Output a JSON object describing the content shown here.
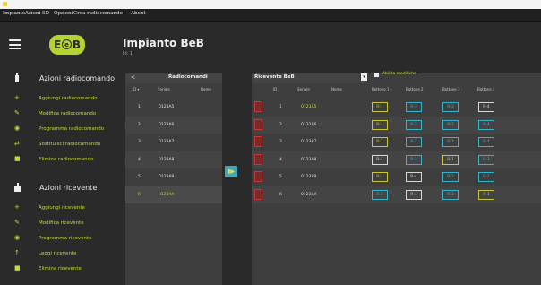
{
  "window": {
    "menu": [
      "Impianto",
      "Azioni SD",
      "Opzioni",
      "Crea radiocomando",
      "About"
    ]
  },
  "app": {
    "title": "Impianto BeB",
    "id": "Id: 1"
  },
  "logo": {
    "text_left": "E",
    "text_center": "e",
    "text_right": "B"
  },
  "sidebar": {
    "remote_heading": "Azioni radiocomando",
    "remote_items": [
      {
        "icon": "+",
        "label": "Aggiungi radiocomando"
      },
      {
        "icon": "✎",
        "label": "Modifica radiocomando"
      },
      {
        "icon": "◉",
        "label": "Programma radiocomando"
      },
      {
        "icon": "⇄",
        "label": "Sostituisci radiocomando"
      },
      {
        "icon": "■",
        "label": "Elimina radiocomando"
      }
    ],
    "receiver_heading": "Azioni ricevente",
    "receiver_items": [
      {
        "icon": "+",
        "label": "Aggiungi ricevente"
      },
      {
        "icon": "✎",
        "label": "Modifica ricevente"
      },
      {
        "icon": "◉",
        "label": "Programma ricevente"
      },
      {
        "icon": "↑",
        "label": "Leggi ricevente"
      },
      {
        "icon": "■",
        "label": "Elimina ricevente"
      }
    ]
  },
  "remotes_panel": {
    "back": "<",
    "title": "Radiocomandi",
    "columns": [
      "ID",
      "Seriale",
      "Nome"
    ],
    "rows": [
      {
        "id": "1",
        "serial": "0123A5",
        "name": "",
        "selected": false
      },
      {
        "id": "2",
        "serial": "0123A6",
        "name": "",
        "selected": false
      },
      {
        "id": "3",
        "serial": "0123A7",
        "name": "",
        "selected": false
      },
      {
        "id": "4",
        "serial": "0123A8",
        "name": "",
        "selected": false
      },
      {
        "id": "5",
        "serial": "0123A9",
        "name": "",
        "selected": false
      },
      {
        "id": "6",
        "serial": "0123AA",
        "name": "",
        "selected": true
      }
    ]
  },
  "transfer_button": {
    "label": "▮▶"
  },
  "receiver_panel": {
    "title": "Ricevente BeB",
    "dropdown": "▾",
    "checkbox_label": "Abilita modifiche",
    "columns": [
      "ID",
      "Seriale",
      "Nome",
      "Bottone 1",
      "Bottone 2",
      "Bottone 3",
      "Bottone 4"
    ],
    "rows": [
      {
        "id": "1",
        "serial": "0123A5",
        "highlight": true,
        "buttons": [
          {
            "t": "R-1",
            "c": "#c9c63a"
          },
          {
            "t": "R-3",
            "c": "#3ab3c9"
          },
          {
            "t": "R-3",
            "c": "#3ab3c9"
          },
          {
            "t": "R-4",
            "c": "#d8d8d8"
          }
        ]
      },
      {
        "id": "2",
        "serial": "0123A6",
        "highlight": false,
        "buttons": [
          {
            "t": "R-1",
            "c": "#c9c63a"
          },
          {
            "t": "R-2",
            "c": "#3ab3c9"
          },
          {
            "t": "R-3",
            "c": "#3ab3c9"
          },
          {
            "t": "R-4",
            "c": "#3ab3c9"
          }
        ]
      },
      {
        "id": "3",
        "serial": "0123A7",
        "highlight": false,
        "buttons": [
          {
            "t": "R-1",
            "c": "#c9c63a"
          },
          {
            "t": "R-2",
            "c": "#3ab3c9"
          },
          {
            "t": "R-3",
            "c": "#3ab3c9"
          },
          {
            "t": "R-4",
            "c": "#3ab3c9"
          }
        ]
      },
      {
        "id": "4",
        "serial": "0123A8",
        "highlight": false,
        "buttons": [
          {
            "t": "R-4",
            "c": "#d8d8d8"
          },
          {
            "t": "R-2",
            "c": "#3ab3c9"
          },
          {
            "t": "R-1",
            "c": "#c9c63a"
          },
          {
            "t": "R-3",
            "c": "#3ab3c9"
          }
        ]
      },
      {
        "id": "5",
        "serial": "0123A9",
        "highlight": false,
        "buttons": [
          {
            "t": "R-1",
            "c": "#c9c63a"
          },
          {
            "t": "R-4",
            "c": "#d8d8d8"
          },
          {
            "t": "R-3",
            "c": "#3ab3c9"
          },
          {
            "t": "R-2",
            "c": "#3ab3c9"
          }
        ]
      },
      {
        "id": "6",
        "serial": "0123AA",
        "highlight": false,
        "buttons": [
          {
            "t": "R-2",
            "c": "#3ab3c9"
          },
          {
            "t": "R-4",
            "c": "#d8d8d8"
          },
          {
            "t": "R-3",
            "c": "#3ab3c9"
          },
          {
            "t": "R-1",
            "c": "#c9c63a"
          }
        ]
      }
    ]
  },
  "colors": {
    "accent": "#c8d83a",
    "teal": "#3ab3c9",
    "selected_row": "#c8d83a",
    "red_marker": "#c23a3a"
  }
}
